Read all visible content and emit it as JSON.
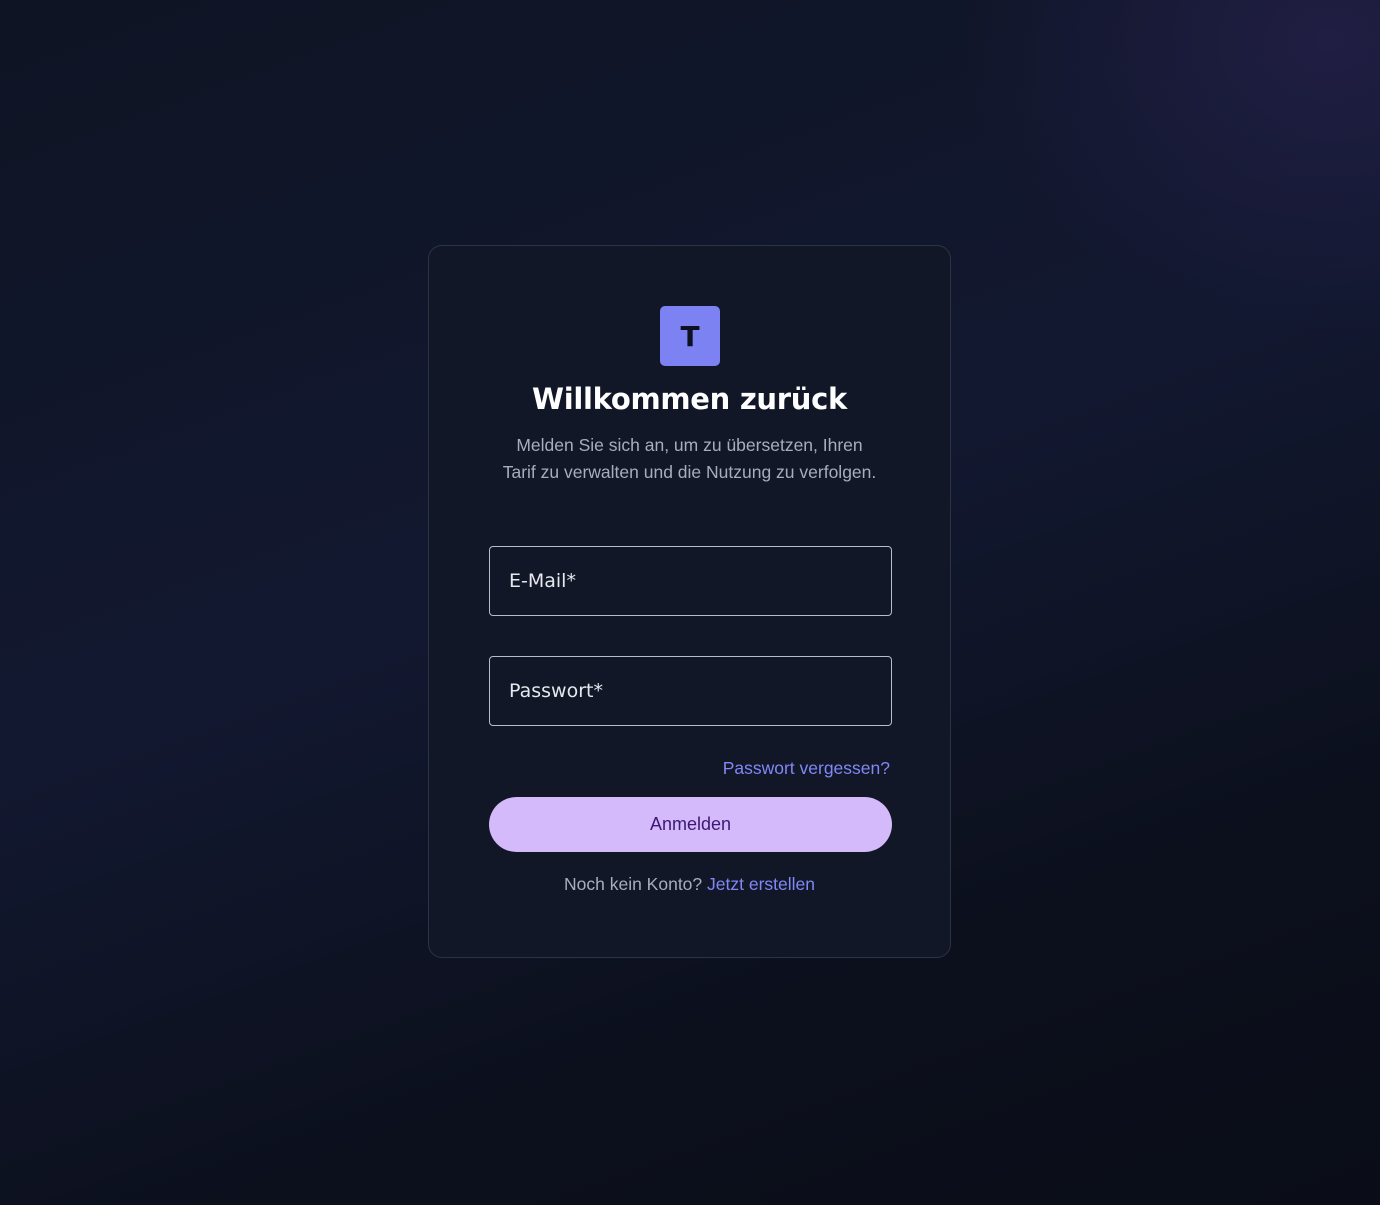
{
  "logo": {
    "letter": "T"
  },
  "login": {
    "title": "Willkommen zurück",
    "subtitle": "Melden Sie sich an, um zu übersetzen, Ihren Tarif zu verwalten und die Nutzung zu verfolgen.",
    "email": {
      "placeholder": "E-Mail*",
      "value": ""
    },
    "password": {
      "placeholder": "Passwort*",
      "value": ""
    },
    "forgot_password": "Passwort vergessen?",
    "submit_label": "Anmelden",
    "no_account_text": "Noch kein Konto?",
    "create_account_link": "Jetzt erstellen"
  },
  "colors": {
    "accent": "#8187f6",
    "logo_bg": "#7d82f3",
    "button_bg": "#d4b9fb",
    "button_text": "#3c1773",
    "card_bg": "#111727",
    "page_bg": "#0f1424"
  }
}
